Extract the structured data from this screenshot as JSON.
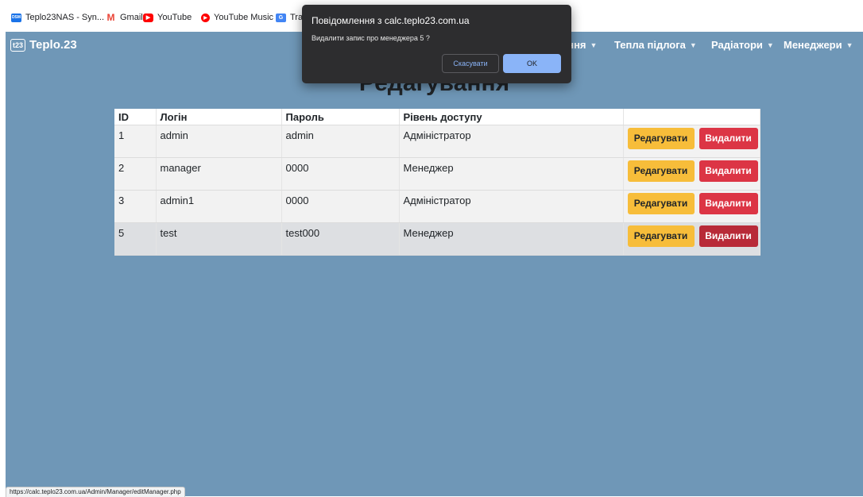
{
  "bookmarks": [
    {
      "label": "Teplo23NAS - Syn...",
      "icon": "dsm-icon",
      "color": "#1a73e8"
    },
    {
      "label": "Gmail",
      "icon": "gmail-icon",
      "color": "#ea4335"
    },
    {
      "label": "YouTube",
      "icon": "youtube-icon",
      "color": "#ff0000"
    },
    {
      "label": "YouTube Music",
      "icon": "youtube-music-icon",
      "color": "#ff0000"
    },
    {
      "label": "Tra",
      "icon": "translate-icon",
      "color": "#4285f4"
    }
  ],
  "navbar": {
    "brand": "Teplo.23",
    "logo_text": "t23",
    "menus": [
      "ення",
      "Тепла підлога",
      "Радіатори",
      "Менеджери"
    ]
  },
  "page": {
    "heading": "Редагування"
  },
  "table": {
    "headers": [
      "ID",
      "Логін",
      "Пароль",
      "Рівень доступу",
      ""
    ],
    "rows": [
      {
        "id": "1",
        "login": "admin",
        "password": "admin",
        "access": "Адміністратор"
      },
      {
        "id": "2",
        "login": "manager",
        "password": "0000",
        "access": "Менеджер"
      },
      {
        "id": "3",
        "login": "admin1",
        "password": "0000",
        "access": "Адміністратор"
      },
      {
        "id": "5",
        "login": "test",
        "password": "test000",
        "access": "Менеджер"
      }
    ],
    "edit_label": "Редагувати",
    "delete_label": "Видалити"
  },
  "dialog": {
    "title": "Повідомлення з calc.teplo23.com.ua",
    "message": "Видалити запис про менеджера 5 ?",
    "cancel_label": "Скасувати",
    "ok_label": "OK"
  },
  "status_url": "https://calc.teplo23.com.ua/Admin/Manager/editManager.php",
  "colors": {
    "page_bg": "#6f97b7",
    "edit_button": "#f7bd3a",
    "delete_button": "#dc3545",
    "dialog_bg": "#2d2d2f",
    "ok_button": "#8ab4f8"
  }
}
